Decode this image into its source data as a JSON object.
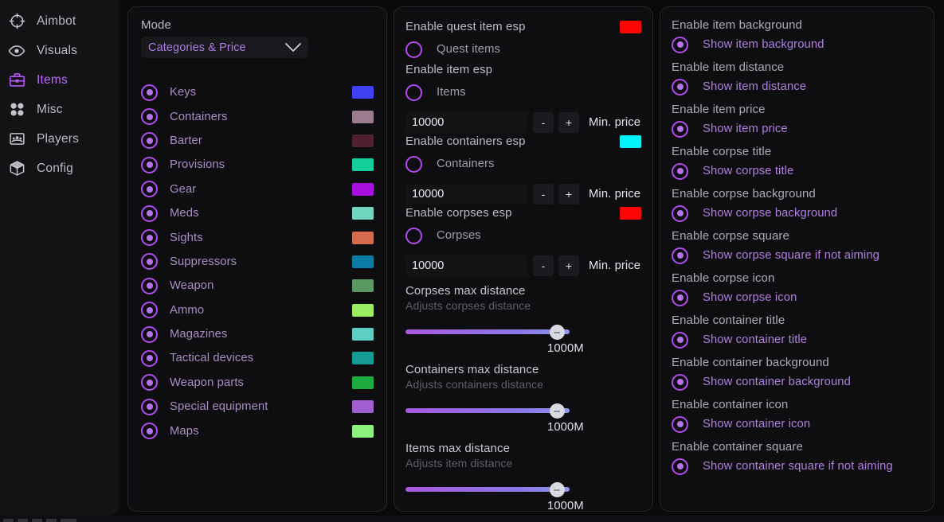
{
  "sidebar": {
    "items": [
      {
        "label": "Aimbot",
        "icon": "crosshair-icon",
        "active": false
      },
      {
        "label": "Visuals",
        "icon": "eye-icon",
        "active": false
      },
      {
        "label": "Items",
        "icon": "toolbox-icon",
        "active": true
      },
      {
        "label": "Misc",
        "icon": "grid-squares-icon",
        "active": false
      },
      {
        "label": "Players",
        "icon": "players-icon",
        "active": false
      },
      {
        "label": "Config",
        "icon": "cube-icon",
        "active": false
      }
    ]
  },
  "panel_categories": {
    "mode_label": "Mode",
    "mode_value": "Categories & Price",
    "chevron": "chevron-down-icon",
    "items": [
      {
        "label": "Keys",
        "checked": true,
        "color": "#4040f5"
      },
      {
        "label": "Containers",
        "checked": true,
        "color": "#9b7a8d"
      },
      {
        "label": "Barter",
        "checked": true,
        "color": "#50202f"
      },
      {
        "label": "Provisions",
        "checked": true,
        "color": "#13cf9b"
      },
      {
        "label": "Gear",
        "checked": true,
        "color": "#a811dd"
      },
      {
        "label": "Meds",
        "checked": true,
        "color": "#70d6c0"
      },
      {
        "label": "Sights",
        "checked": true,
        "color": "#d4694d"
      },
      {
        "label": "Suppressors",
        "checked": true,
        "color": "#0b7ba6"
      },
      {
        "label": "Weapon",
        "checked": true,
        "color": "#5b9a63"
      },
      {
        "label": "Ammo",
        "checked": true,
        "color": "#9ced62"
      },
      {
        "label": "Magazines",
        "checked": true,
        "color": "#5dcec2"
      },
      {
        "label": "Tactical devices",
        "checked": true,
        "color": "#169a96"
      },
      {
        "label": "Weapon parts",
        "checked": true,
        "color": "#1cab3f"
      },
      {
        "label": "Special equipment",
        "checked": true,
        "color": "#a15ed0"
      },
      {
        "label": "Maps",
        "checked": true,
        "color": "#8ef080"
      }
    ]
  },
  "panel_esp": {
    "groups": [
      {
        "label": "Enable quest item esp",
        "toggle": "Quest items",
        "checked": false,
        "color": "#fc0505",
        "price": null
      },
      {
        "label": "Enable item esp",
        "toggle": "Items",
        "checked": false,
        "color": null,
        "price": {
          "value": "10000",
          "minus": "-",
          "plus": "+",
          "caption": "Min. price"
        }
      },
      {
        "label": "Enable containers esp",
        "toggle": "Containers",
        "checked": false,
        "color": "#00f6f6",
        "price": {
          "value": "10000",
          "minus": "-",
          "plus": "+",
          "caption": "Min. price"
        }
      },
      {
        "label": "Enable corpses esp",
        "toggle": "Corpses",
        "checked": false,
        "color": "#fc0505",
        "price": {
          "value": "10000",
          "minus": "-",
          "plus": "+",
          "caption": "Min. price"
        }
      }
    ],
    "sliders": [
      {
        "title": "Corpses max distance",
        "subtitle": "Adjusts corpses distance",
        "value": "1000M",
        "percent": 92
      },
      {
        "title": "Containers max distance",
        "subtitle": "Adjusts containers distance",
        "value": "1000M",
        "percent": 92
      },
      {
        "title": "Items max distance",
        "subtitle": "Adjusts item distance",
        "value": "1000M",
        "percent": 92
      }
    ]
  },
  "panel_display": {
    "groups": [
      {
        "label": "Enable item background",
        "toggle": "Show item background",
        "checked": true
      },
      {
        "label": "Enable item distance",
        "toggle": "Show item distance",
        "checked": true
      },
      {
        "label": "Enable item price",
        "toggle": "Show item price",
        "checked": true
      },
      {
        "label": "Enable corpse title",
        "toggle": "Show corpse title",
        "checked": true
      },
      {
        "label": "Enable corpse background",
        "toggle": "Show corpse background",
        "checked": true
      },
      {
        "label": "Enable corpse square",
        "toggle": "Show corpse square if not aiming",
        "checked": true
      },
      {
        "label": "Enable corpse icon",
        "toggle": "Show corpse icon",
        "checked": true
      },
      {
        "label": "Enable container title",
        "toggle": "Show container title",
        "checked": true
      },
      {
        "label": "Enable container background",
        "toggle": "Show container background",
        "checked": true
      },
      {
        "label": "Enable container icon",
        "toggle": "Show container icon",
        "checked": true
      },
      {
        "label": "Enable container square",
        "toggle": "Show container square if not aiming",
        "checked": true
      }
    ]
  },
  "theme": {
    "accent": "#b24bf0",
    "accent_text": "#b07fe0",
    "panel_bg": "#0e0e10",
    "app_bg": "#0a0a0b"
  }
}
